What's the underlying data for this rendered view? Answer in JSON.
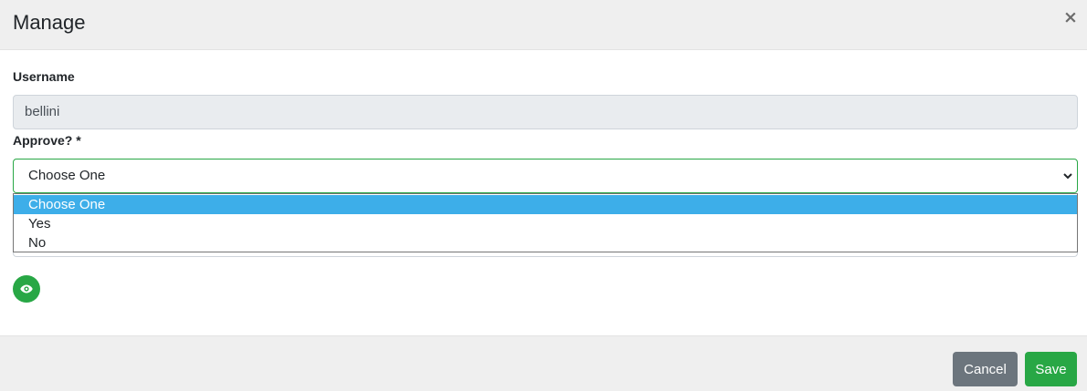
{
  "modal": {
    "title": "Manage",
    "close_label": "×"
  },
  "form": {
    "username": {
      "label": "Username",
      "value": "bellini"
    },
    "approve": {
      "label": "Approve? *",
      "selected": "Choose One",
      "options": [
        "Choose One",
        "Yes",
        "No"
      ],
      "highlighted_index": 0
    }
  },
  "icons": {
    "view": "eye-icon",
    "select_arrow": "chevron-down-icon"
  },
  "footer": {
    "cancel_label": "Cancel",
    "save_label": "Save"
  },
  "colors": {
    "accent_green": "#28a745",
    "cancel_gray": "#6c757d",
    "option_highlight": "#3daee9",
    "header_bg": "#efefef"
  }
}
